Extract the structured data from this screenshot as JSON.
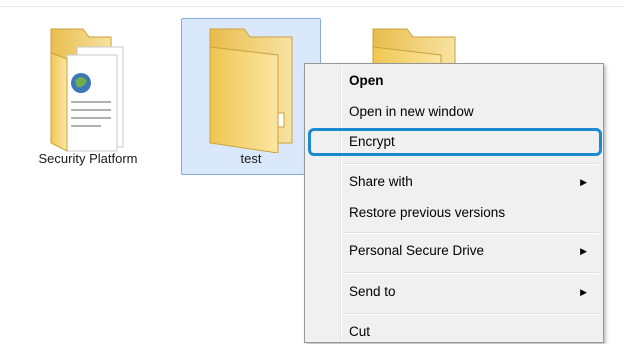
{
  "folders": [
    {
      "label": "Security Platform",
      "selected": false,
      "icon": "folder-with-documents-icon"
    },
    {
      "label": "test",
      "selected": true,
      "icon": "folder-icon"
    },
    {
      "label": "",
      "selected": false,
      "icon": "folder-icon"
    }
  ],
  "context_menu": {
    "items": [
      {
        "label": "Open",
        "bold": true,
        "submenu": false
      },
      {
        "label": "Open in new window",
        "bold": false,
        "submenu": false
      },
      {
        "label": "Encrypt",
        "bold": false,
        "submenu": false,
        "highlighted": true
      },
      {
        "label": "Share with",
        "bold": false,
        "submenu": true
      },
      {
        "label": "Restore previous versions",
        "bold": false,
        "submenu": false
      },
      {
        "label": "Personal Secure Drive",
        "bold": false,
        "submenu": true
      },
      {
        "label": "Send to",
        "bold": false,
        "submenu": true
      },
      {
        "label": "Cut",
        "bold": false,
        "submenu": false
      }
    ]
  },
  "colors": {
    "highlight_border": "#1c8ad0",
    "selection_bg": "#d9e9fb",
    "folder_yellow": "#f3d46b"
  }
}
